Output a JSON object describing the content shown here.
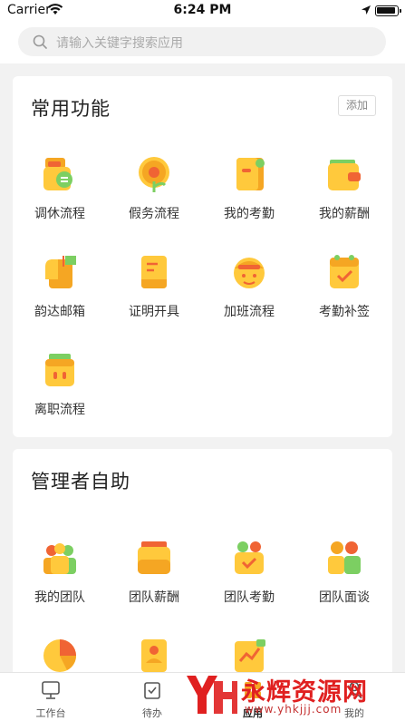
{
  "status_bar": {
    "carrier": "Carrier",
    "time": "6:24 PM"
  },
  "search": {
    "placeholder": "请输入关键字搜索应用"
  },
  "common": {
    "title": "常用功能",
    "add_label": "添加",
    "items": [
      {
        "label": "调休流程",
        "icon": "leave-swap-icon"
      },
      {
        "label": "假务流程",
        "icon": "sunflower-leave-icon"
      },
      {
        "label": "我的考勤",
        "icon": "attendance-icon"
      },
      {
        "label": "我的薪酬",
        "icon": "wallet-salary-icon"
      },
      {
        "label": "韵达邮箱",
        "icon": "mailbox-icon"
      },
      {
        "label": "证明开具",
        "icon": "certificate-icon"
      },
      {
        "label": "加班流程",
        "icon": "overtime-face-icon"
      },
      {
        "label": "考勤补签",
        "icon": "calendar-check-icon"
      },
      {
        "label": "离职流程",
        "icon": "resign-bag-icon"
      }
    ]
  },
  "manager": {
    "title": "管理者自助",
    "items": [
      {
        "label": "我的团队",
        "icon": "team-icon"
      },
      {
        "label": "团队薪酬",
        "icon": "team-salary-icon"
      },
      {
        "label": "团队考勤",
        "icon": "team-attendance-icon"
      },
      {
        "label": "团队面谈",
        "icon": "team-interview-icon"
      },
      {
        "label": "",
        "icon": "pie-chart-icon"
      },
      {
        "label": "",
        "icon": "profile-card-icon"
      },
      {
        "label": "",
        "icon": "report-chart-icon"
      }
    ]
  },
  "tabbar": {
    "tabs": [
      {
        "label": "工作台",
        "icon": "monitor-icon"
      },
      {
        "label": "待办",
        "icon": "todo-check-icon"
      },
      {
        "label": "应用",
        "icon": "apps-icon"
      },
      {
        "label": "我的",
        "icon": "user-icon"
      }
    ]
  },
  "watermark": {
    "text": "永辉资源网",
    "url": "www.yhkjjj.com"
  },
  "colors": {
    "accent_orange": "#f5a623",
    "accent_yellow": "#ffc93c",
    "accent_green": "#7ccf62",
    "accent_red": "#f06434"
  }
}
